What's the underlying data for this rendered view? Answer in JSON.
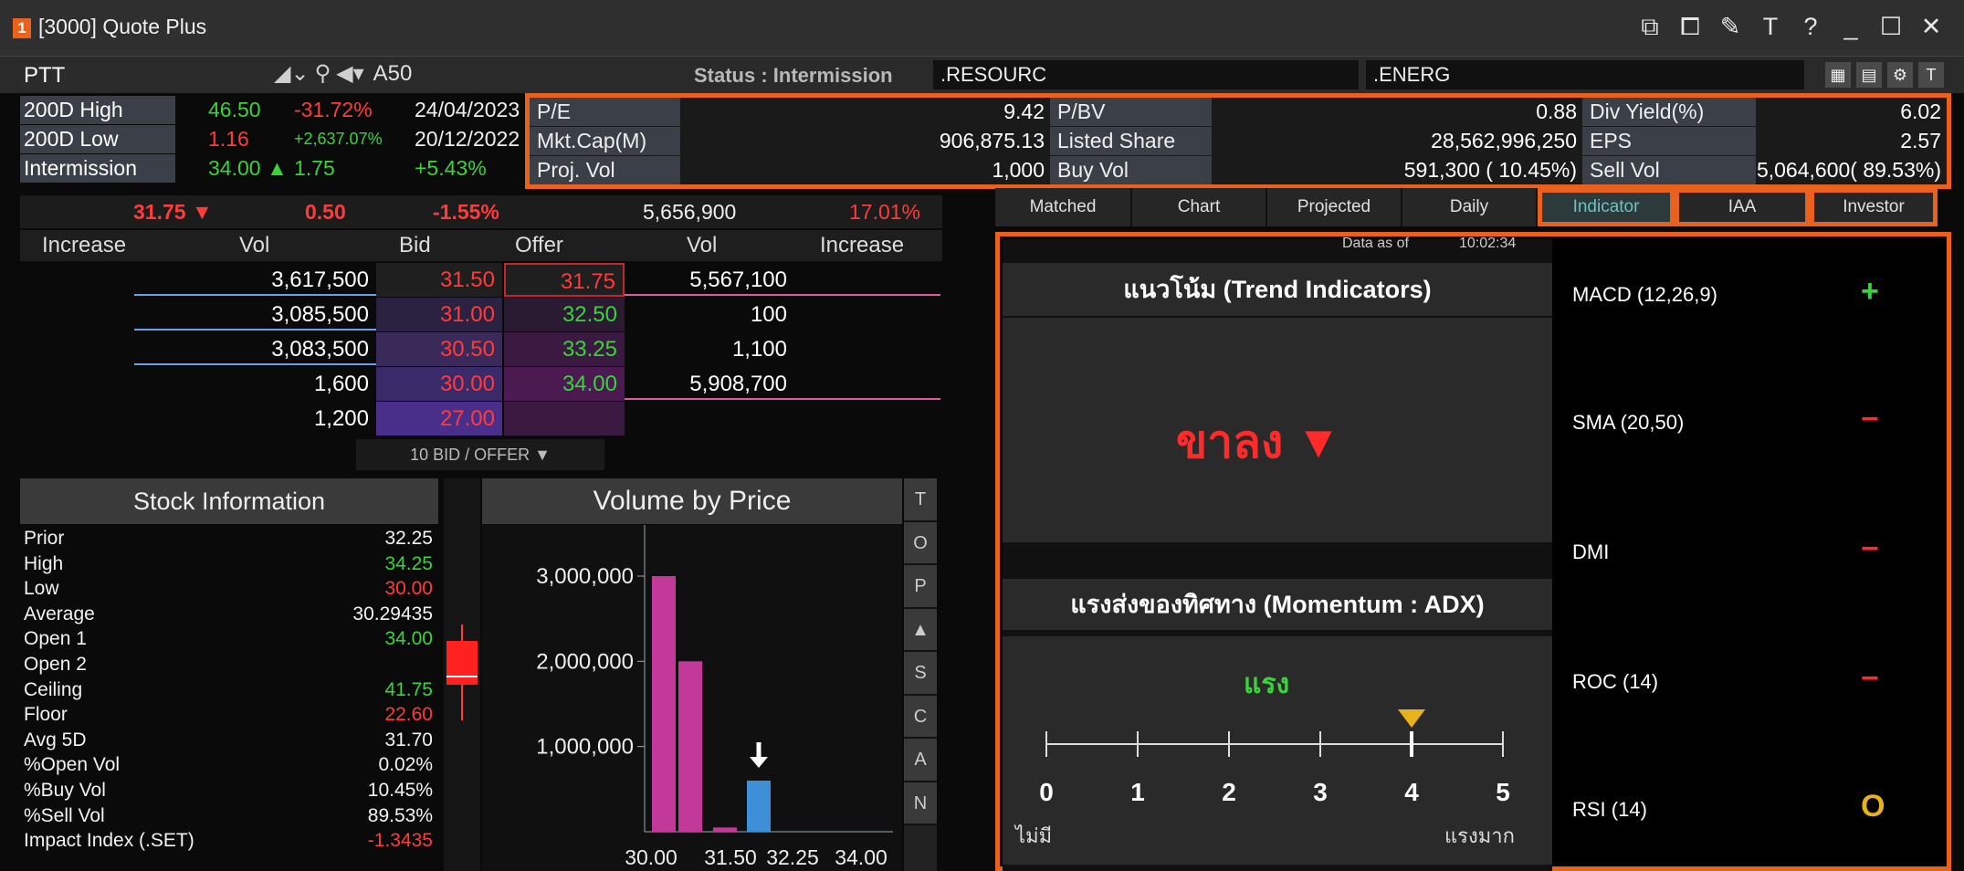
{
  "window": {
    "badge": "1",
    "title": "[3000] Quote Plus",
    "icons": [
      "popout-icon",
      "restore-icon",
      "pin-icon",
      "font-icon",
      "help-icon",
      "minimize-icon",
      "maximize-icon",
      "close-icon"
    ],
    "icon_glyphs": [
      "⧉",
      "⧠",
      "✎",
      "T",
      "?",
      "_",
      "☐",
      "✕"
    ]
  },
  "symbol": {
    "value": "PTT",
    "mode": "A50"
  },
  "status": "Status : Intermission",
  "sectors": [
    ".RESOURC",
    ".ENERG"
  ],
  "high_low": [
    {
      "label": "200D High",
      "price": "46.50",
      "change": "-31.72%",
      "date": "24/04/2023",
      "price_color": "#3bd23b",
      "change_color": "#ff3b3b"
    },
    {
      "label": "200D Low",
      "price": "1.16",
      "change": "+2,637.07%",
      "date": "20/12/2022",
      "price_color": "#ff3b3b",
      "change_color": "#3bd23b"
    },
    {
      "label": "Intermission",
      "price": "34.00 ▲",
      "change": "1.75",
      "date": "+5.43%",
      "price_color": "#3bd23b",
      "change_color": "#3bd23b"
    }
  ],
  "stats": [
    [
      {
        "label": "P/E",
        "value": "9.42"
      },
      {
        "label": "P/BV",
        "value": "0.88"
      },
      {
        "label": "Div Yield(%)",
        "value": "6.02"
      }
    ],
    [
      {
        "label": "Mkt.Cap(M)",
        "value": "906,875.13"
      },
      {
        "label": "Listed Share",
        "value": "28,562,996,250"
      },
      {
        "label": "EPS",
        "value": "2.57"
      }
    ],
    [
      {
        "label": "Proj. Vol",
        "value": "1,000"
      },
      {
        "label": "Buy Vol",
        "value": "591,300 ( 10.45%)"
      },
      {
        "label": "Sell Vol",
        "value": "5,064,600( 89.53%)"
      }
    ]
  ],
  "price": {
    "last": "31.75 ▼",
    "change": "0.50",
    "pct": "-1.55%",
    "volume": "5,656,900",
    "pct2": "17.01%"
  },
  "orderbook": {
    "headers": [
      "Increase",
      "Vol",
      "Bid",
      "Offer",
      "Vol",
      "Increase"
    ],
    "rows": [
      {
        "bid_vol": "3,617,500",
        "bid": "31.50",
        "offer": "31.75",
        "offer_vol": "5,567,100"
      },
      {
        "bid_vol": "3,085,500",
        "bid": "31.00",
        "offer": "32.50",
        "offer_vol": "100"
      },
      {
        "bid_vol": "3,083,500",
        "bid": "30.50",
        "offer": "33.25",
        "offer_vol": "1,100"
      },
      {
        "bid_vol": "1,600",
        "bid": "30.00",
        "offer": "34.00",
        "offer_vol": "5,908,700"
      },
      {
        "bid_vol": "1,200",
        "bid": "27.00",
        "offer": "",
        "offer_vol": ""
      }
    ],
    "more": "10 BID / OFFER ▼"
  },
  "stock_info": {
    "title": "Stock Information",
    "rows": [
      {
        "k": "Prior",
        "v": "32.25",
        "c": "#f2f2f2"
      },
      {
        "k": "High",
        "v": "34.25",
        "c": "#3bd23b"
      },
      {
        "k": "Low",
        "v": "30.00",
        "c": "#ff3b3b"
      },
      {
        "k": "Average",
        "v": "30.29435",
        "c": "#f2f2f2"
      },
      {
        "k": "Open 1",
        "v": "34.00",
        "c": "#3bd23b"
      },
      {
        "k": "Open 2",
        "v": "",
        "c": "#f2f2f2"
      },
      {
        "k": "Ceiling",
        "v": "41.75",
        "c": "#3bd23b"
      },
      {
        "k": "Floor",
        "v": "22.60",
        "c": "#ff3b3b"
      },
      {
        "k": "Avg 5D",
        "v": "31.70",
        "c": "#f2f2f2"
      },
      {
        "k": "%Open Vol",
        "v": "0.02%",
        "c": "#f2f2f2"
      },
      {
        "k": "%Buy Vol",
        "v": "10.45%",
        "c": "#f2f2f2"
      },
      {
        "k": "%Sell Vol",
        "v": "89.53%",
        "c": "#f2f2f2"
      },
      {
        "k": "Impact Index (.SET)",
        "v": "-1.3435",
        "c": "#ff3b3b"
      }
    ]
  },
  "vbp_title": "Volume by Price",
  "side_buttons": [
    "T",
    "O",
    "P",
    "▲",
    "S",
    "C",
    "A",
    "N"
  ],
  "chart_data": {
    "type": "bar",
    "title": "Volume by Price",
    "categories": [
      "30.00",
      "30.50",
      "31.00",
      "31.50",
      "32.25",
      "34.00"
    ],
    "x_tick_labels": [
      "30.00",
      "31.50",
      "32.25",
      "34.00"
    ],
    "values": [
      3000000,
      2000000,
      50000,
      600000,
      0,
      0
    ],
    "colors": [
      "#c2399a",
      "#c2399a",
      "#c2399a",
      "#3d8fd8",
      "#c2399a",
      "#c2399a"
    ],
    "y_ticks": [
      "3,000,000",
      "2,000,000",
      "1,000,000"
    ],
    "ylim": [
      0,
      3600000
    ],
    "marker_category": "31.50"
  },
  "tabs": [
    "Matched",
    "Chart",
    "Projected",
    "Daily",
    "Indicator",
    "IAA",
    "Investor"
  ],
  "data_as_of": {
    "label": "Data as of",
    "time": "10:02:34"
  },
  "trend": {
    "title": "แนวโน้ม (Trend Indicators)",
    "signal": "ขาลง ▼"
  },
  "momentum": {
    "title": "แรงส่งของทิศทาง (Momentum : ADX)",
    "strength": "แรง",
    "value": 4,
    "ticks": [
      "0",
      "1",
      "2",
      "3",
      "4",
      "5"
    ],
    "left": "ไม่มี",
    "right": "แรงมาก"
  },
  "indicators": [
    {
      "name": "MACD (12,26,9)",
      "signal": "+",
      "color": "#3bd23b"
    },
    {
      "name": "SMA (20,50)",
      "signal": "−",
      "color": "#ff2b2b"
    },
    {
      "name": "DMI",
      "signal": "−",
      "color": "#ff2b2b"
    },
    {
      "name": "ROC (14)",
      "signal": "−",
      "color": "#ff2b2b"
    },
    {
      "name": "RSI (14)",
      "signal": "O",
      "color": "#e8b21d"
    }
  ]
}
